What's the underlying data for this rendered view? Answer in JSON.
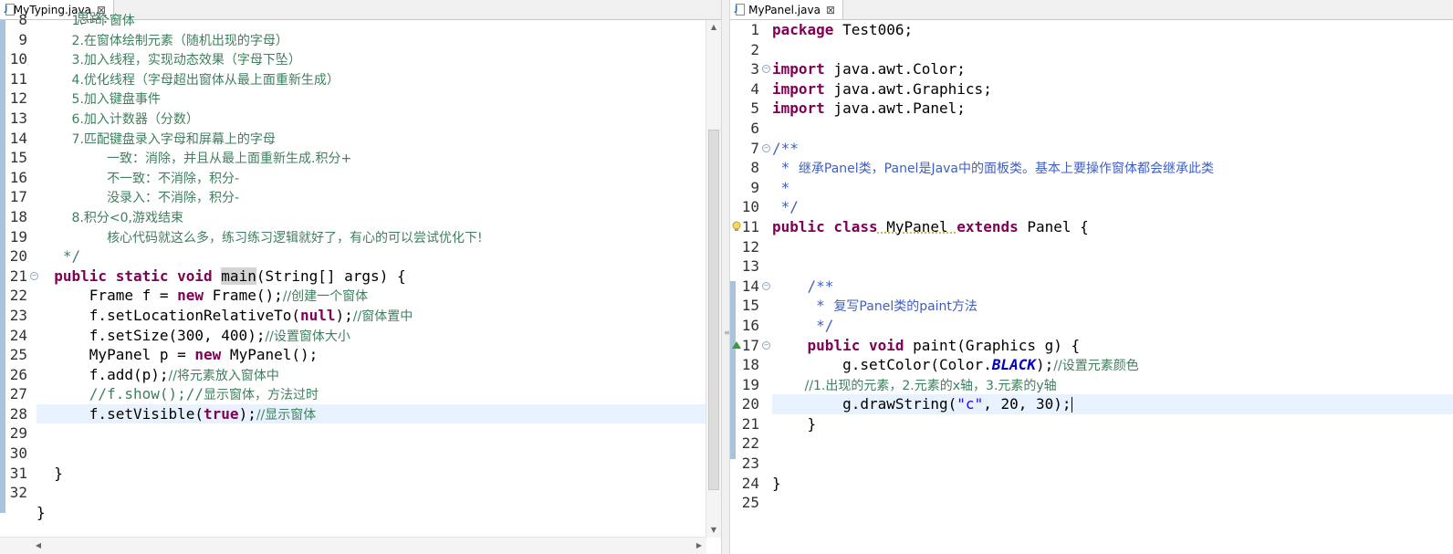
{
  "left_editor": {
    "tab_title": "MyTyping.java",
    "close_glyph": "⊠",
    "line_numbers": [
      "8",
      "9",
      "10",
      "11",
      "12",
      "13",
      "14",
      "15",
      "16",
      "17",
      "18",
      "19",
      "20",
      "21",
      "22",
      "23",
      "24",
      "25",
      "26",
      "27",
      "28",
      "29",
      "30",
      "31",
      "32"
    ],
    "partial_top_text": "思路：",
    "comment_lines": [
      "1.一个窗体",
      "2.在窗体绘制元素（随机出现的字母）",
      "3.加入线程，实现动态效果（字母下坠）",
      "4.优化线程（字母超出窗体从最上面重新生成）",
      "5.加入键盘事件",
      "6.加入计数器（分数）",
      "7.匹配键盘录入字母和屏幕上的字母",
      "一致：消除，并且从最上面重新生成.积分+",
      "不一致：不消除，积分-",
      "没录入：不消除，积分-",
      "8.积分<0,游戏结束",
      "核心代码就这么多，练习练习逻辑就好了，有心的可以尝试优化下!",
      "*/"
    ],
    "code": {
      "l21_kw": "public static void",
      "l21_method": "main",
      "l21_rest": "(String[] args) {",
      "l22_a": "Frame f = ",
      "l22_kw": "new",
      "l22_b": " Frame();",
      "l22_c": "//创建一个窗体",
      "l23_a": "f.setLocationRelativeTo(",
      "l23_kw": "null",
      "l23_b": ");",
      "l23_c": "//窗体置中",
      "l24_a": "f.setSize(300, 400);",
      "l24_c": "//设置窗体大小",
      "l25_a": "MyPanel p = ",
      "l25_kw": "new",
      "l25_b": " MyPanel();",
      "l26_a": "f.add(p);",
      "l26_c": "//将元素放入窗体中",
      "l27_c1": "//f.show();//",
      "l27_c2": "显示窗体，方法过时",
      "l28_a": "f.setVisible(",
      "l28_kw": "true",
      "l28_b": ");",
      "l28_c": "//显示窗体",
      "l31": "}",
      "l33": "}"
    }
  },
  "right_editor": {
    "tab_title": "MyPanel.java",
    "close_glyph": "⊠",
    "line_numbers": [
      "1",
      "2",
      "3",
      "4",
      "5",
      "6",
      "7",
      "8",
      "9",
      "10",
      "11",
      "12",
      "13",
      "14",
      "15",
      "16",
      "17",
      "18",
      "19",
      "20",
      "21",
      "22",
      "23",
      "24",
      "25"
    ],
    "code": {
      "l1_kw": "package",
      "l1_rest": " Test006;",
      "l3_kw": "import",
      "l3_rest": " java.awt.Color;",
      "l4_kw": "import",
      "l4_rest": " java.awt.Graphics;",
      "l5_kw": "import",
      "l5_rest": " java.awt.Panel;",
      "l7": "/**",
      "l8_a": " * ",
      "l8_b": "继承Panel类，Panel是Java中的面板类。基本上要操作窗体都会继承此类",
      "l9": " *",
      "l10": " */",
      "l11_kw1": "public class",
      "l11_name": " MyPanel ",
      "l11_kw2": "extends",
      "l11_rest": " Panel {",
      "l14": "    /**",
      "l15_a": "     * ",
      "l15_b": "复写Panel类的paint方法",
      "l16": "     */",
      "l17_kw": "    public void",
      "l17_rest": " paint(Graphics g) {",
      "l18_a": "        g.setColor(Color.",
      "l18_const": "BLACK",
      "l18_b": ");",
      "l18_c": "//设置元素颜色",
      "l19_c": "        //1.出现的元素，2.元素的x轴，3.元素的y轴",
      "l20_a": "        g.drawString(",
      "l20_str": "\"c\"",
      "l20_b": ", 20, 30);",
      "l21": "    }",
      "l24": "}"
    }
  },
  "colors": {
    "keyword": "#7f0055",
    "comment": "#3f7f5f",
    "javadoc": "#3f5fbf",
    "string": "#2a00ff",
    "constant": "#0000c0",
    "current_line": "#e8f2fe"
  }
}
